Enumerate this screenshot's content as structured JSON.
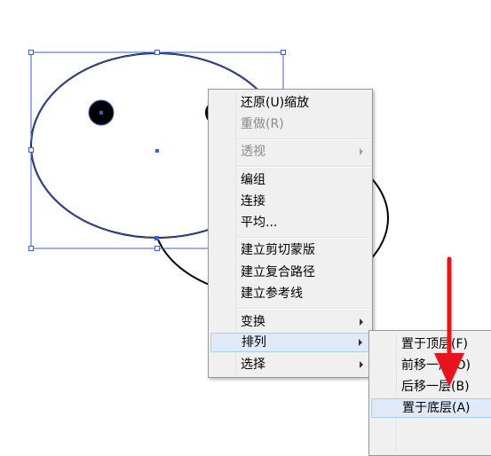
{
  "main_menu": {
    "items": [
      {
        "label": "还原(U)缩放",
        "enabled": true,
        "submenu": false
      },
      {
        "label": "重做(R)",
        "enabled": false,
        "submenu": false
      },
      {
        "label": "透视",
        "enabled": false,
        "submenu": true
      },
      {
        "label": "编组",
        "enabled": true,
        "submenu": false
      },
      {
        "label": "连接",
        "enabled": true,
        "submenu": false
      },
      {
        "label": "平均...",
        "enabled": true,
        "submenu": false
      },
      {
        "label": "建立剪切蒙版",
        "enabled": true,
        "submenu": false
      },
      {
        "label": "建立复合路径",
        "enabled": true,
        "submenu": false
      },
      {
        "label": "建立参考线",
        "enabled": true,
        "submenu": false
      },
      {
        "label": "变换",
        "enabled": true,
        "submenu": true
      },
      {
        "label": "排列",
        "enabled": true,
        "submenu": true,
        "highlighted": true
      },
      {
        "label": "选择",
        "enabled": true,
        "submenu": true
      }
    ]
  },
  "arrange_submenu": {
    "items": [
      {
        "label": "置于顶层(F)"
      },
      {
        "label": "前移一层(O)"
      },
      {
        "label": "后移一层(B)"
      },
      {
        "label": "置于底层(A)",
        "highlighted": true
      }
    ]
  },
  "colors": {
    "selection_blue": "#3b5fcd",
    "annotation_red": "#e8141b",
    "menu_bg": "#f0f0f0",
    "highlight_bg": "#dfe9f8"
  }
}
